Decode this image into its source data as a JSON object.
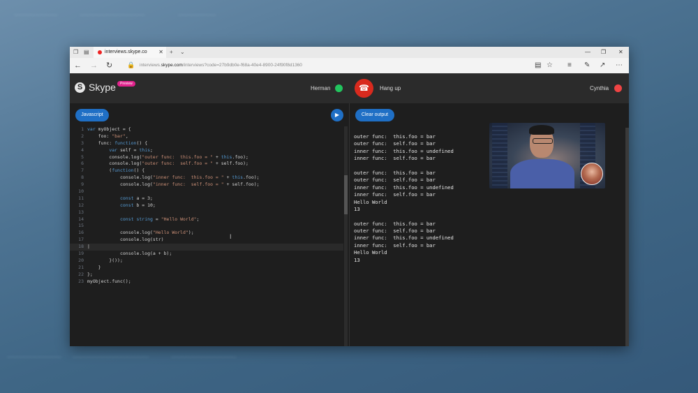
{
  "browser": {
    "tab_title": "interviews.skype.co",
    "url_prefix": "interviews.",
    "url_domain": "skype.com",
    "url_path": "/interviews?code=27b9db0e-f68a-40e4-8900-24f90f8d1360"
  },
  "header": {
    "logo_text": "Skype",
    "badge": "Preview",
    "participant_left": "Herman",
    "participant_left_status_color": "#22c55e",
    "hangup_label": "Hang up",
    "participant_right": "Cynthia",
    "participant_right_status_color": "#ef4444"
  },
  "editor": {
    "language_button": "Javascript",
    "clear_button": "Clear output"
  },
  "output_lines": [
    "outer func:  this.foo = bar",
    "outer func:  self.foo = bar",
    "inner func:  this.foo = undefined",
    "inner func:  self.foo = bar",
    "",
    "outer func:  this.foo = bar",
    "outer func:  self.foo = bar",
    "inner func:  this.foo = undefined",
    "inner func:  self.foo = bar",
    "Hello World",
    "13",
    "",
    "outer func:  this.foo = bar",
    "outer func:  self.foo = bar",
    "inner func:  this.foo = undefined",
    "inner func:  self.foo = bar",
    "Hello World",
    "13"
  ]
}
